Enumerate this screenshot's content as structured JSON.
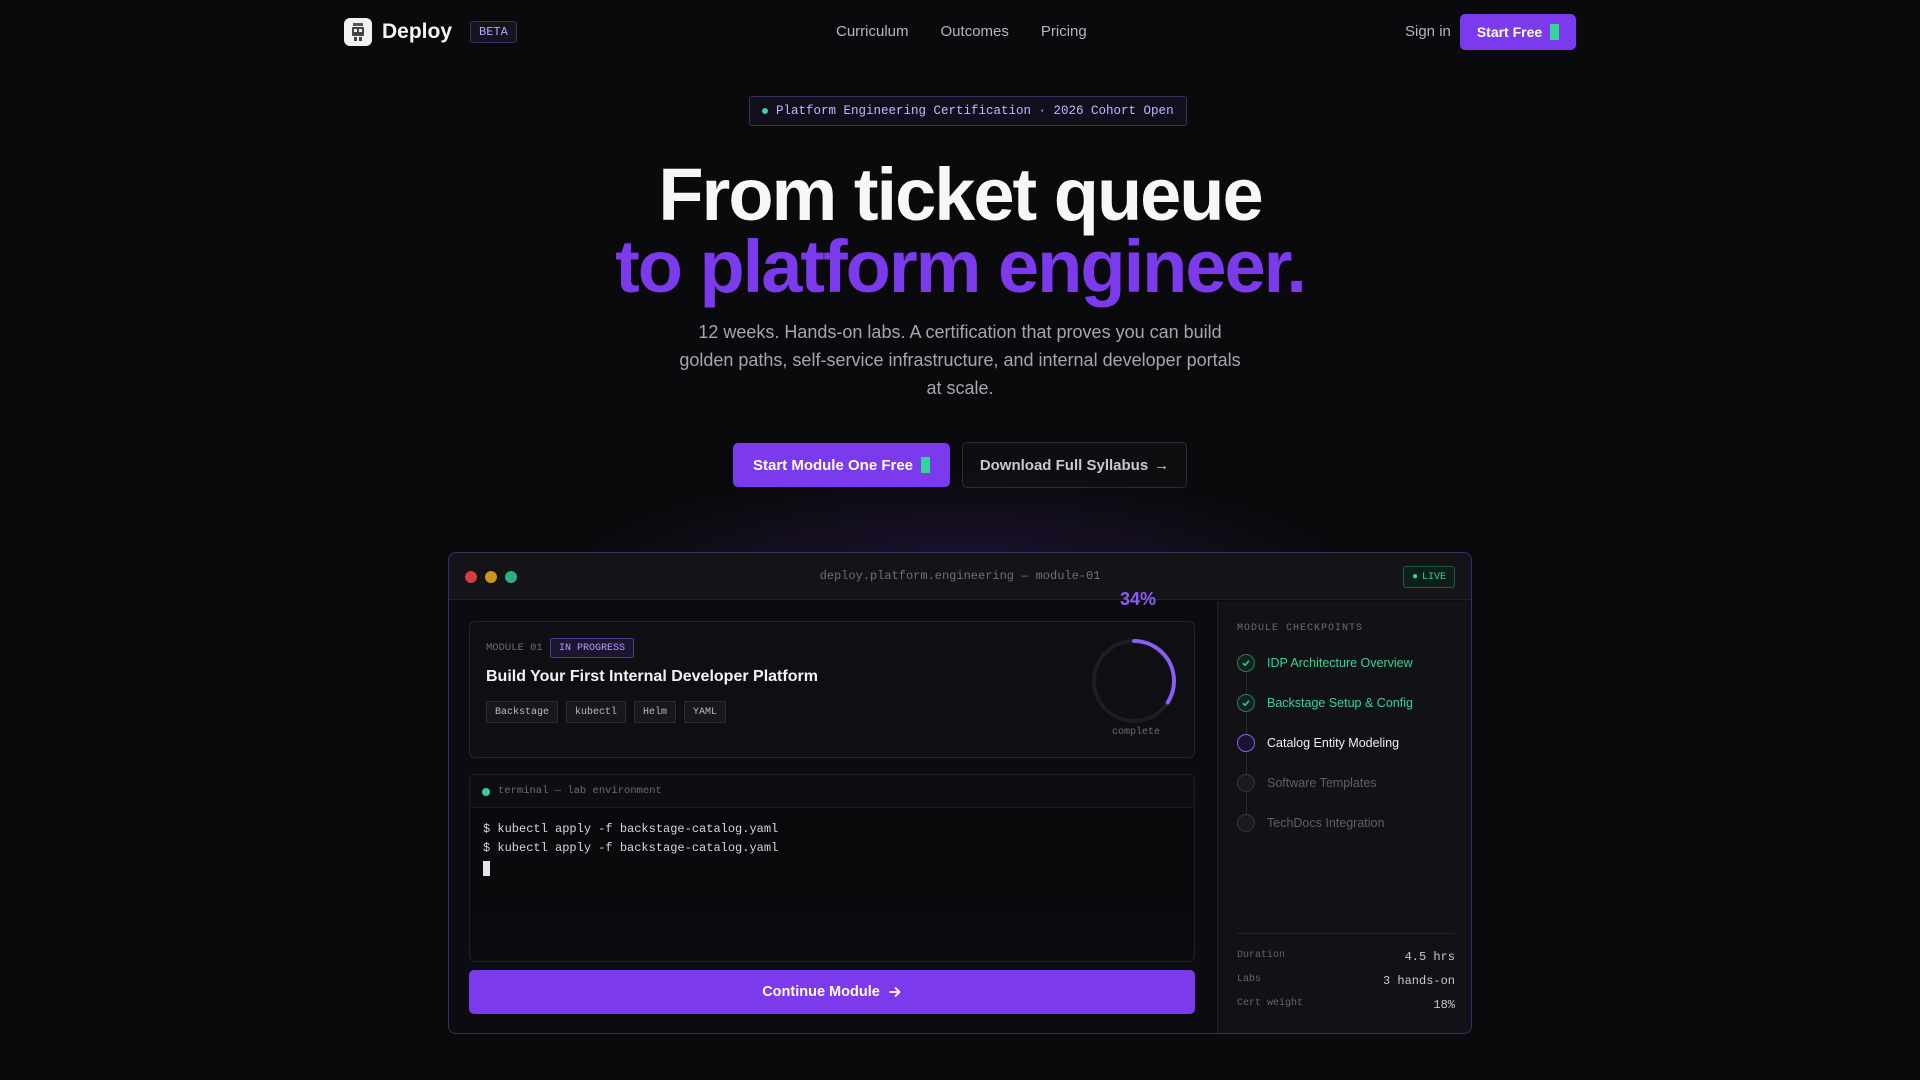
{
  "nav": {
    "brand": "Deploy",
    "badge": "BETA",
    "links": [
      "Curriculum",
      "Outcomes",
      "Pricing"
    ],
    "signin": "Sign in",
    "start": "Start Free"
  },
  "hero": {
    "eyebrow": "Platform Engineering Certification · 2026 Cohort Open",
    "title_line1": "From ticket queue",
    "title_line2": "to platform engineer.",
    "subtitle": "12 weeks. Hands-on labs. A certification that proves you can build golden paths, self-service infrastructure, and internal developer portals at scale.",
    "cta_primary": "Start Module One Free",
    "cta_secondary": "Download Full Syllabus",
    "cta_secondary_arrow": "→"
  },
  "window": {
    "title": "deploy.platform.engineering — module-01",
    "live": "LIVE",
    "module": {
      "label": "MODULE 01",
      "status": "IN PROGRESS",
      "title": "Build Your First Internal Developer Platform",
      "tags": [
        "Backstage",
        "kubectl",
        "Helm",
        "YAML"
      ],
      "progress_pct": "34%",
      "progress_value": 0.34,
      "progress_caption": "complete"
    },
    "terminal": {
      "title": "terminal — lab environment",
      "lines": [
        "$ kubectl apply -f backstage-catalog.yaml",
        "$ kubectl apply -f backstage-catalog.yaml"
      ]
    },
    "continue": "Continue Module",
    "checkpoints": {
      "heading": "MODULE CHECKPOINTS",
      "items": [
        {
          "label": "IDP Architecture Overview",
          "state": "done"
        },
        {
          "label": "Backstage Setup & Config",
          "state": "done"
        },
        {
          "label": "Catalog Entity Modeling",
          "state": "current"
        },
        {
          "label": "Software Templates",
          "state": "todo"
        },
        {
          "label": "TechDocs Integration",
          "state": "todo"
        }
      ]
    },
    "stats": [
      {
        "key": "Duration",
        "value": "4.5 hrs"
      },
      {
        "key": "Labs",
        "value": "3 hands-on"
      },
      {
        "key": "Cert weight",
        "value": "18%"
      }
    ]
  },
  "colors": {
    "accent": "#7c3aed",
    "success": "#34d399",
    "background": "#0a0a0c"
  }
}
